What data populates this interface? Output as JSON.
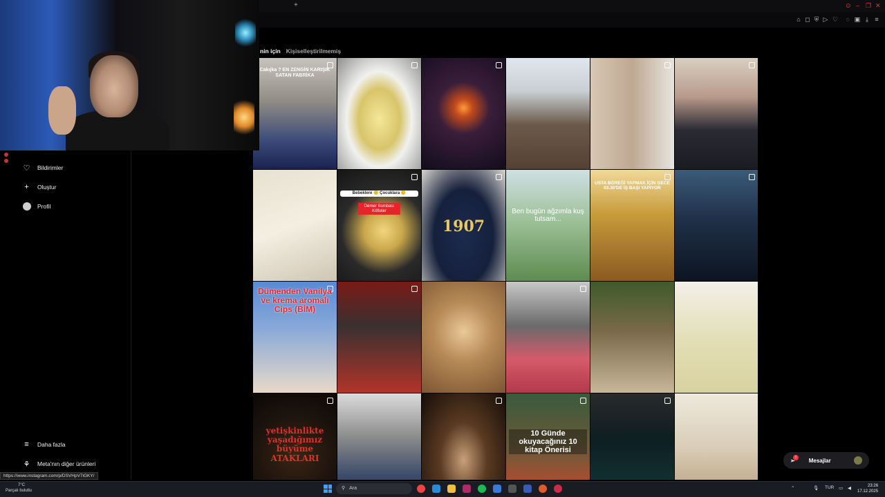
{
  "browser": {
    "tab_title": "m",
    "new_tab_symbol": "+",
    "minimize": "–",
    "restore": "❐",
    "close": "✕"
  },
  "explore": {
    "tab_active": "nin için",
    "tab_inactive": "Kişiselleştirilmemiş"
  },
  "sidebar": {
    "notifications": "Bildirimler",
    "create": "Oluştur",
    "profile": "Profil",
    "more": "Daha fazla",
    "meta": "Meta'nın diğer ürünleri"
  },
  "tiles": [
    {
      "caption": "Cakıjka ? EN ZENGİN KARIŞIK SATAN FABRİKA",
      "cap_color": "#ffffff"
    },
    {
      "caption": "",
      "cap_color": "#ffffff"
    },
    {
      "caption": "",
      "cap_color": "#ffffff"
    },
    {
      "caption": "",
      "cap_color": "#ffffff"
    },
    {
      "caption": "",
      "cap_color": "#ffffff"
    },
    {
      "caption": "",
      "cap_color": "#ffffff"
    },
    {
      "caption": "",
      "cap_color": "#ffffff"
    },
    {
      "caption": "Bebeklere 🙂 Çocuklara 🙂",
      "cap_color": "#222222"
    },
    {
      "caption": "1907",
      "cap_color": "#e8c860"
    },
    {
      "caption": "Ben bugün ağzımla kuş tutsam...",
      "cap_color": "#ffffff"
    },
    {
      "caption": "USTA BÖREĞİ YAPMAK İÇİN GECE 03.30'DE İŞ BAŞI YAPIYOR",
      "cap_color": "#ffffff"
    },
    {
      "caption": "",
      "cap_color": "#ffffff"
    },
    {
      "caption": "Dümenden Vanilya ve krema aromalı Cips (BİM)",
      "cap_color": "#e8262a"
    },
    {
      "caption": "",
      "cap_color": "#ffffff"
    },
    {
      "caption": "",
      "cap_color": "#ffffff"
    },
    {
      "caption": "",
      "cap_color": "#ffffff"
    },
    {
      "caption": "",
      "cap_color": "#ffffff"
    },
    {
      "caption": "",
      "cap_color": "#ffffff"
    },
    {
      "caption": "yetişkinlikte yaşadığımız büyüme ATAKLARI",
      "cap_color": "#e0322a"
    },
    {
      "caption": "",
      "cap_color": "#ffffff"
    },
    {
      "caption": "",
      "cap_color": "#ffffff"
    },
    {
      "caption": "10 Günde okuyacağınız 10 kitap Önerisi",
      "cap_color": "#ffffff"
    },
    {
      "caption": "",
      "cap_color": "#ffffff"
    },
    {
      "caption": "",
      "cap_color": "#ffffff"
    }
  ],
  "tile7_sticker": "Demer Bombası Köfteler",
  "messages": {
    "label": "Mesajlar",
    "badge": "1"
  },
  "status_url": "https://www.instagram.com/p/DSVHpV7iGKY/",
  "taskbar": {
    "weather_temp": "7°C",
    "weather_desc": "Parçalı bulutlu",
    "search_placeholder": "Ara",
    "lang": "TUR",
    "time": "23:26",
    "date": "17.12.2025"
  }
}
